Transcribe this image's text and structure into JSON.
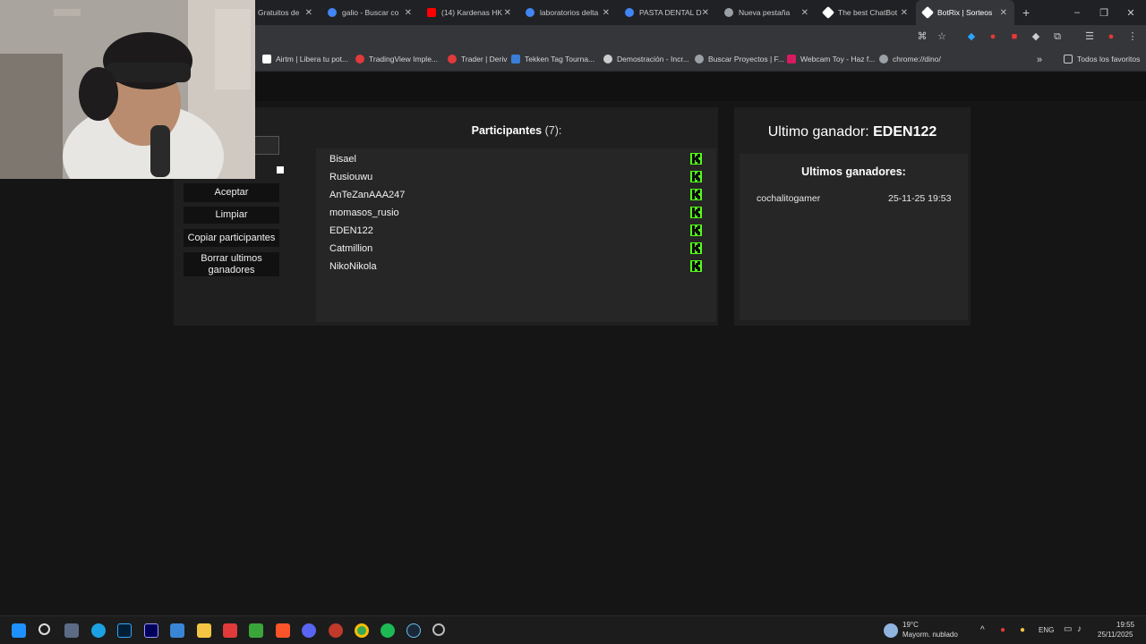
{
  "browser": {
    "tabs": [
      {
        "title": "Gratuitos de",
        "color": "#8a8a8a"
      },
      {
        "title": "galio - Buscar co",
        "color": "#4285f4"
      },
      {
        "title": "(14) Kardenas HK",
        "color": "#ff0000"
      },
      {
        "title": "laboratorios delta",
        "color": "#4285f4"
      },
      {
        "title": "PASTA DENTAL D",
        "color": "#4285f4"
      },
      {
        "title": "Nueva pestaña",
        "color": "#9aa0a6"
      },
      {
        "title": "The best ChatBot",
        "color": "#ffffff"
      },
      {
        "title": "BotRix | Sorteos",
        "color": "#ffffff"
      }
    ],
    "new_tab_glyph": "+",
    "bookmarks": [
      {
        "label": "Airtm | Libera tu pot...",
        "color": "#ffffff"
      },
      {
        "label": "TradingView Imple...",
        "color": "#e03a3a"
      },
      {
        "label": "Trader | Deriv",
        "color": "#e03a3a"
      },
      {
        "label": "Tekken Tag Tourna...",
        "color": "#3b7dd8"
      },
      {
        "label": "Demostración - Incr...",
        "color": "#cccccc"
      },
      {
        "label": "Buscar Proyectos | F...",
        "color": "#9aa0a6"
      },
      {
        "label": "Webcam Toy - Haz f...",
        "color": "#d81b60"
      },
      {
        "label": "chrome://dino/",
        "color": "#9aa0a6"
      }
    ],
    "all_bookmarks": "Todos los favoritos"
  },
  "controls": {
    "accept": "Aceptar",
    "clear": "Limpiar",
    "copy": "Copiar participantes",
    "delete_winners": "Borrar ultimos ganadores"
  },
  "participants": {
    "title": "Participantes",
    "count": "(7):",
    "list": [
      "Bisael",
      "Rusiouwu",
      "AnTeZanAAA247",
      "momasos_rusio",
      "EDEN122",
      "Catmillion",
      "NikoNikola"
    ],
    "platform_color": "#53fc18"
  },
  "winner": {
    "label": "Ultimo ganador:",
    "name": "EDEN122",
    "history_title": "Ultimos ganadores:",
    "history": [
      {
        "name": "cochalitogamer",
        "date": "25-11-25 19:53"
      }
    ]
  },
  "taskbar": {
    "weather_temp": "19°C",
    "weather_desc": "Mayorm. nublado",
    "lang": "ENG",
    "time": "19:55",
    "date": "25/11/2025"
  }
}
